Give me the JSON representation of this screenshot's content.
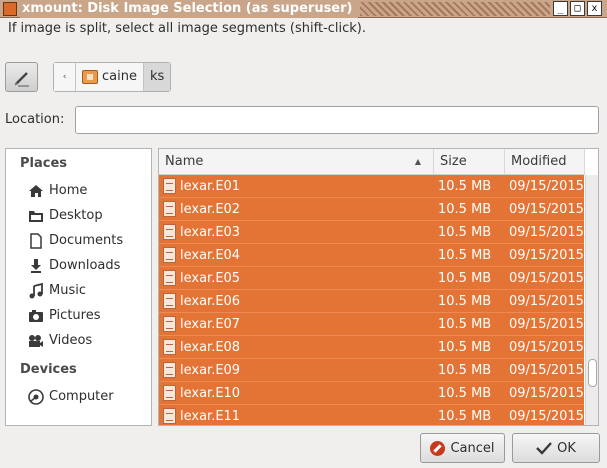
{
  "window": {
    "title": "xmount: Disk Image Selection (as superuser)",
    "minimize_glyph": "_",
    "maximize_glyph": "□",
    "close_glyph": "x"
  },
  "hint": "If image is split, select all image segments (shift-click).",
  "pathbar": {
    "back_glyph": "‹",
    "crumbs": [
      "caine",
      "ks"
    ]
  },
  "location": {
    "label": "Location:",
    "value": "",
    "placeholder": ""
  },
  "sidebar": {
    "places_heading": "Places",
    "devices_heading": "Devices",
    "places": [
      {
        "label": "Home",
        "icon": "home-icon"
      },
      {
        "label": "Desktop",
        "icon": "desktop-icon"
      },
      {
        "label": "Documents",
        "icon": "documents-icon"
      },
      {
        "label": "Downloads",
        "icon": "downloads-icon"
      },
      {
        "label": "Music",
        "icon": "music-icon"
      },
      {
        "label": "Pictures",
        "icon": "pictures-icon"
      },
      {
        "label": "Videos",
        "icon": "videos-icon"
      }
    ],
    "devices": [
      {
        "label": "Computer",
        "icon": "computer-icon"
      }
    ]
  },
  "filelist": {
    "columns": {
      "name": "Name",
      "size": "Size",
      "modified": "Modified"
    },
    "sort_glyph": "▲",
    "selection_color": "#e37436",
    "rows": [
      {
        "name": "lexar.E01",
        "size": "10.5 MB",
        "modified": "09/15/2015"
      },
      {
        "name": "lexar.E02",
        "size": "10.5 MB",
        "modified": "09/15/2015"
      },
      {
        "name": "lexar.E03",
        "size": "10.5 MB",
        "modified": "09/15/2015"
      },
      {
        "name": "lexar.E04",
        "size": "10.5 MB",
        "modified": "09/15/2015"
      },
      {
        "name": "lexar.E05",
        "size": "10.5 MB",
        "modified": "09/15/2015"
      },
      {
        "name": "lexar.E06",
        "size": "10.5 MB",
        "modified": "09/15/2015"
      },
      {
        "name": "lexar.E07",
        "size": "10.5 MB",
        "modified": "09/15/2015"
      },
      {
        "name": "lexar.E08",
        "size": "10.5 MB",
        "modified": "09/15/2015"
      },
      {
        "name": "lexar.E09",
        "size": "10.5 MB",
        "modified": "09/15/2015"
      },
      {
        "name": "lexar.E10",
        "size": "10.5 MB",
        "modified": "09/15/2015"
      },
      {
        "name": "lexar.E11",
        "size": "10.5 MB",
        "modified": "09/15/2015"
      }
    ]
  },
  "buttons": {
    "cancel": "Cancel",
    "ok": "OK"
  }
}
